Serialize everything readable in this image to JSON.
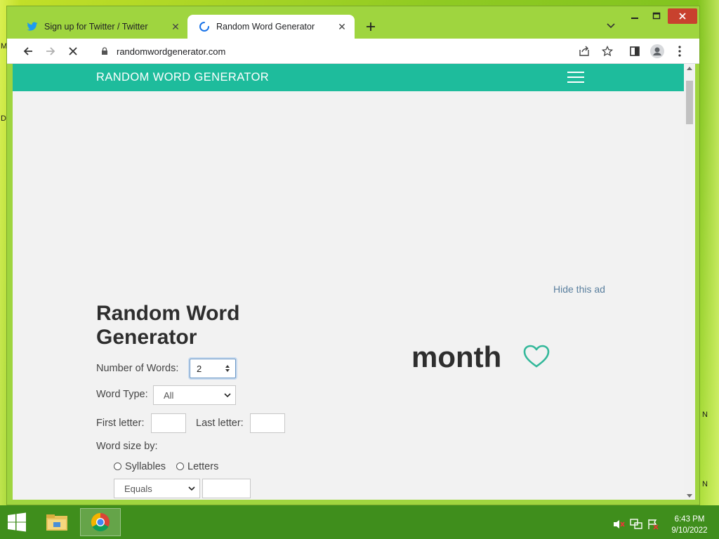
{
  "browser": {
    "tabs": [
      {
        "label": "Sign up for Twitter / Twitter",
        "icon": "twitter-bird-icon",
        "active": false
      },
      {
        "label": "Random Word Generator",
        "icon": "loading-spinner-icon",
        "active": true
      }
    ],
    "address": "randomwordgenerator.com"
  },
  "site": {
    "header_title": "RANDOM WORD GENERATOR",
    "hide_ad": "Hide this ad",
    "main_title": "Random Word Generator",
    "form": {
      "number_label": "Number of Words:",
      "number_value": "2",
      "word_type_label": "Word Type:",
      "word_type_value": "All",
      "first_letter_label": "First letter:",
      "last_letter_label": "Last letter:",
      "word_size_label": "Word size by:",
      "radio_syllables": "Syllables",
      "radio_letters": "Letters",
      "size_mode_value": "Equals"
    },
    "generated_word": "month"
  },
  "taskbar": {
    "time": "6:43 PM",
    "date": "9/10/2022"
  },
  "desktop": {
    "left_chars": [
      "M",
      "D"
    ],
    "right_chars": [
      "N",
      "N"
    ]
  },
  "colors": {
    "site_header": "#1ebc9c",
    "heart": "#33b89a",
    "taskbar": "#3f8e1c"
  }
}
